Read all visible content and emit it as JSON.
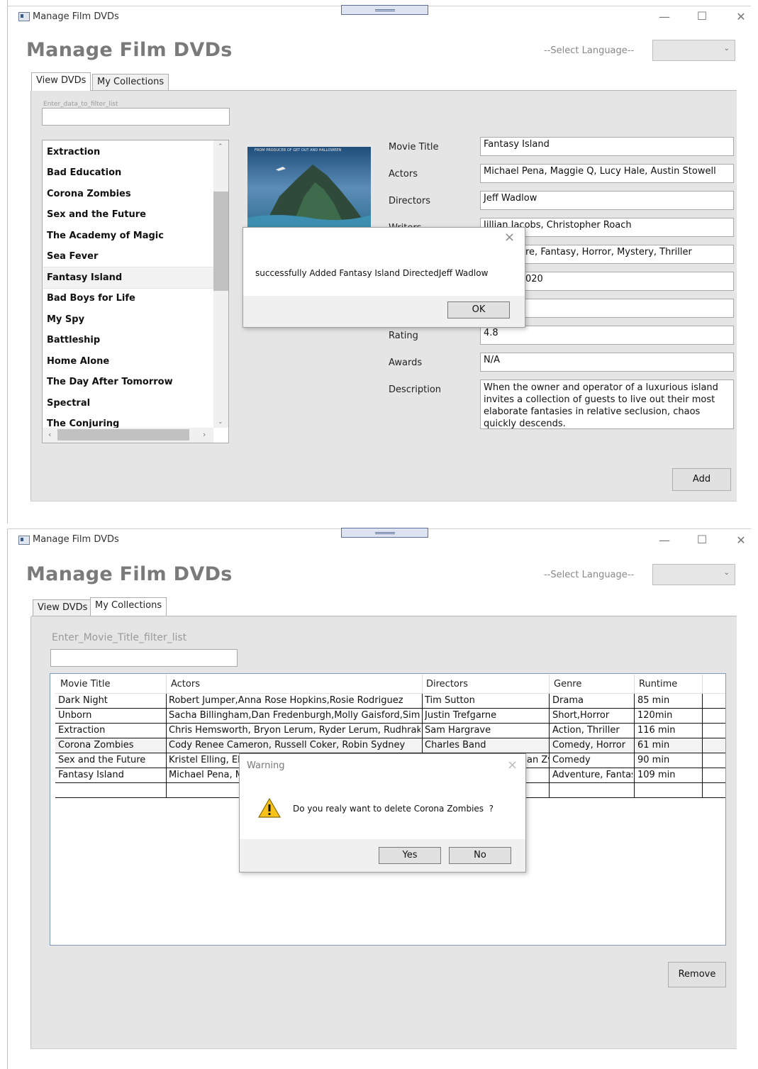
{
  "window1": {
    "title": "Manage Film DVDs",
    "app_title": "Manage Film DVDs",
    "language_label": "--Select Language--",
    "combo_value": "",
    "tabs": [
      {
        "label": "View DVDs"
      },
      {
        "label": "My Collections"
      }
    ],
    "filter_placeholder": "Enter_data_to_filter_list",
    "movie_list": [
      "Extraction",
      "Bad Education",
      "Corona Zombies",
      "Sex and the Future",
      "The Academy of Magic",
      "Sea Fever",
      "Fantasy Island",
      "Bad Boys for Life",
      "My Spy",
      "Battleship",
      "Home Alone",
      "The Day After Tomorrow",
      "Spectral",
      "The Conjuring"
    ],
    "selected_movie": "Fantasy Island",
    "poster_caption": "FROM PRODUCER OF GET OUT AND HALLOWEEN",
    "fields": {
      "labels": [
        "Movie Title",
        "Actors",
        "Directors",
        "Writers",
        "Rating",
        "Awards",
        "Description"
      ],
      "movie_title": "Fantasy Island",
      "actors": "Michael Pena, Maggie Q, Lucy Hale, Austin Stowell",
      "directors": "Jeff Wadlow",
      "writers": "Jillian Jacobs, Christopher Roach",
      "genre_partial": "re, Fantasy, Horror, Mystery, Thriller",
      "year_partial": "020",
      "rating": "4.8",
      "awards": "N/A",
      "description": "When the owner and operator of a luxurious island invites a collection of guests to live out their most elaborate fantasies in relative seclusion, chaos quickly descends."
    },
    "add_button": "Add",
    "dialog": {
      "message": "successfully Added Fantasy Island DirectedJeff Wadlow",
      "ok": "OK",
      "close": "×"
    }
  },
  "window2": {
    "title": "Manage Film DVDs",
    "app_title": "Manage Film DVDs",
    "language_label": "--Select Language--",
    "combo_value": "",
    "tabs": [
      {
        "label": "View DVDs"
      },
      {
        "label": "My Collections"
      }
    ],
    "filter_label": "Enter_Movie_Title_filter_list",
    "filter_value": "",
    "table": {
      "columns": [
        "Movie Title",
        "Actors",
        "Directors",
        "Genre",
        "Runtime"
      ],
      "rows": [
        [
          "Dark Night",
          "Robert Jumper,Anna Rose Hopkins,Rosie Rodriguez",
          "Tim Sutton",
          "Drama",
          "85 min"
        ],
        [
          "Unborn",
          "Sacha Billingham,Dan Fredenburgh,Molly Gaisford,Simo",
          "Justin Trefgarne",
          "Short,Horror",
          "120min"
        ],
        [
          "Extraction",
          "Chris Hemsworth, Bryon Lerum, Ryder Lerum, Rudhraks",
          "Sam Hargrave",
          "Action, Thriller",
          "116 min"
        ],
        [
          "Corona Zombies",
          "Cody Renee Cameron, Russell Coker, Robin Sydney",
          "Charles Band",
          "Comedy, Horror",
          "61 min"
        ],
        [
          "Sex and the Future",
          "Kristel Elling, Ell",
          "an Zv",
          "Comedy",
          "90 min"
        ],
        [
          "Fantasy Island",
          "Michael Pena, M",
          "",
          "Adventure, Fantas",
          "109 min"
        ]
      ]
    },
    "remove_button": "Remove",
    "dialog": {
      "title": "Warning",
      "message": "Do you realy want to delete Corona Zombies  ?",
      "yes": "Yes",
      "no": "No",
      "close": "×"
    }
  },
  "window_controls": {
    "minimize": "—",
    "maximize": "☐",
    "close": "✕"
  }
}
